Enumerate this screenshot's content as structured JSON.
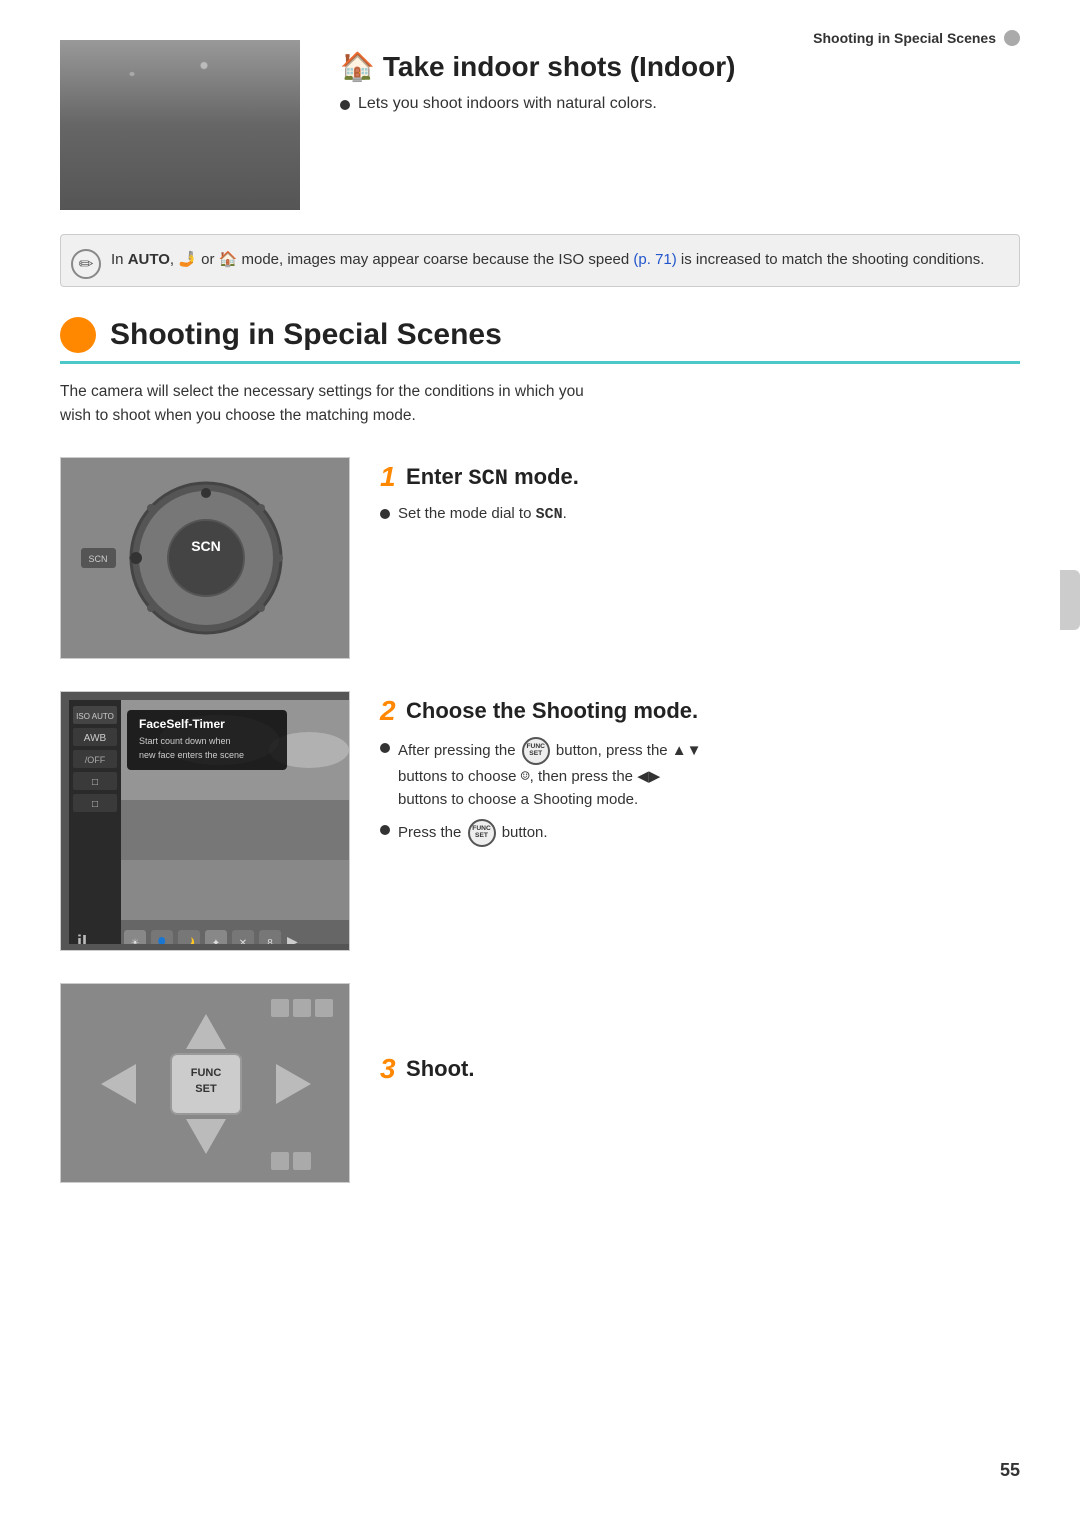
{
  "page": {
    "number": "55",
    "top_label": "Shooting in Special Scenes"
  },
  "indoor_section": {
    "title": "Take indoor shots (Indoor)",
    "icon": "🏠",
    "bullet": "Lets you shoot indoors with natural colors."
  },
  "note_box": {
    "text_before_link": "In ",
    "modes": "AUTO, face, or indoor",
    "modes_display": "🅐, 🤳 or 🏠",
    "text_main": " mode, images may appear coarse because the ISO speed ",
    "link_text": "(p. 71)",
    "text_after": " is increased to match the shooting conditions."
  },
  "shooting_section": {
    "title": "Shooting in Special Scenes",
    "description_line1": "The camera will select the necessary settings for the conditions in which you",
    "description_line2": "wish to shoot when you choose the matching mode."
  },
  "step1": {
    "number": "1",
    "title": "Enter SCN mode.",
    "bullet": "Set the mode dial to SCN.",
    "scn_text": "SCN"
  },
  "step2": {
    "number": "2",
    "title": "Choose the Shooting mode.",
    "bullet1_before": "After pressing the ",
    "bullet1_button": "FUNC SET",
    "bullet1_mid": " button, press the ▲▼",
    "bullet1_after": "buttons to choose ",
    "bullet1_icon": "SCN icon",
    "bullet1_end": ", then press the ◀▶",
    "bullet1_last": "buttons to choose a Shooting mode.",
    "bullet2_before": "Press the ",
    "bullet2_button": "FUNC SET",
    "bullet2_after": " button.",
    "menu_popup": {
      "title": "FaceSelf-Timer",
      "text": "Start count down when new face enters the scene"
    },
    "sidebar_items": [
      "ISO AUTO",
      "AWB",
      "/OFF",
      "□",
      "□"
    ]
  },
  "step3": {
    "number": "3",
    "title": "Shoot."
  }
}
